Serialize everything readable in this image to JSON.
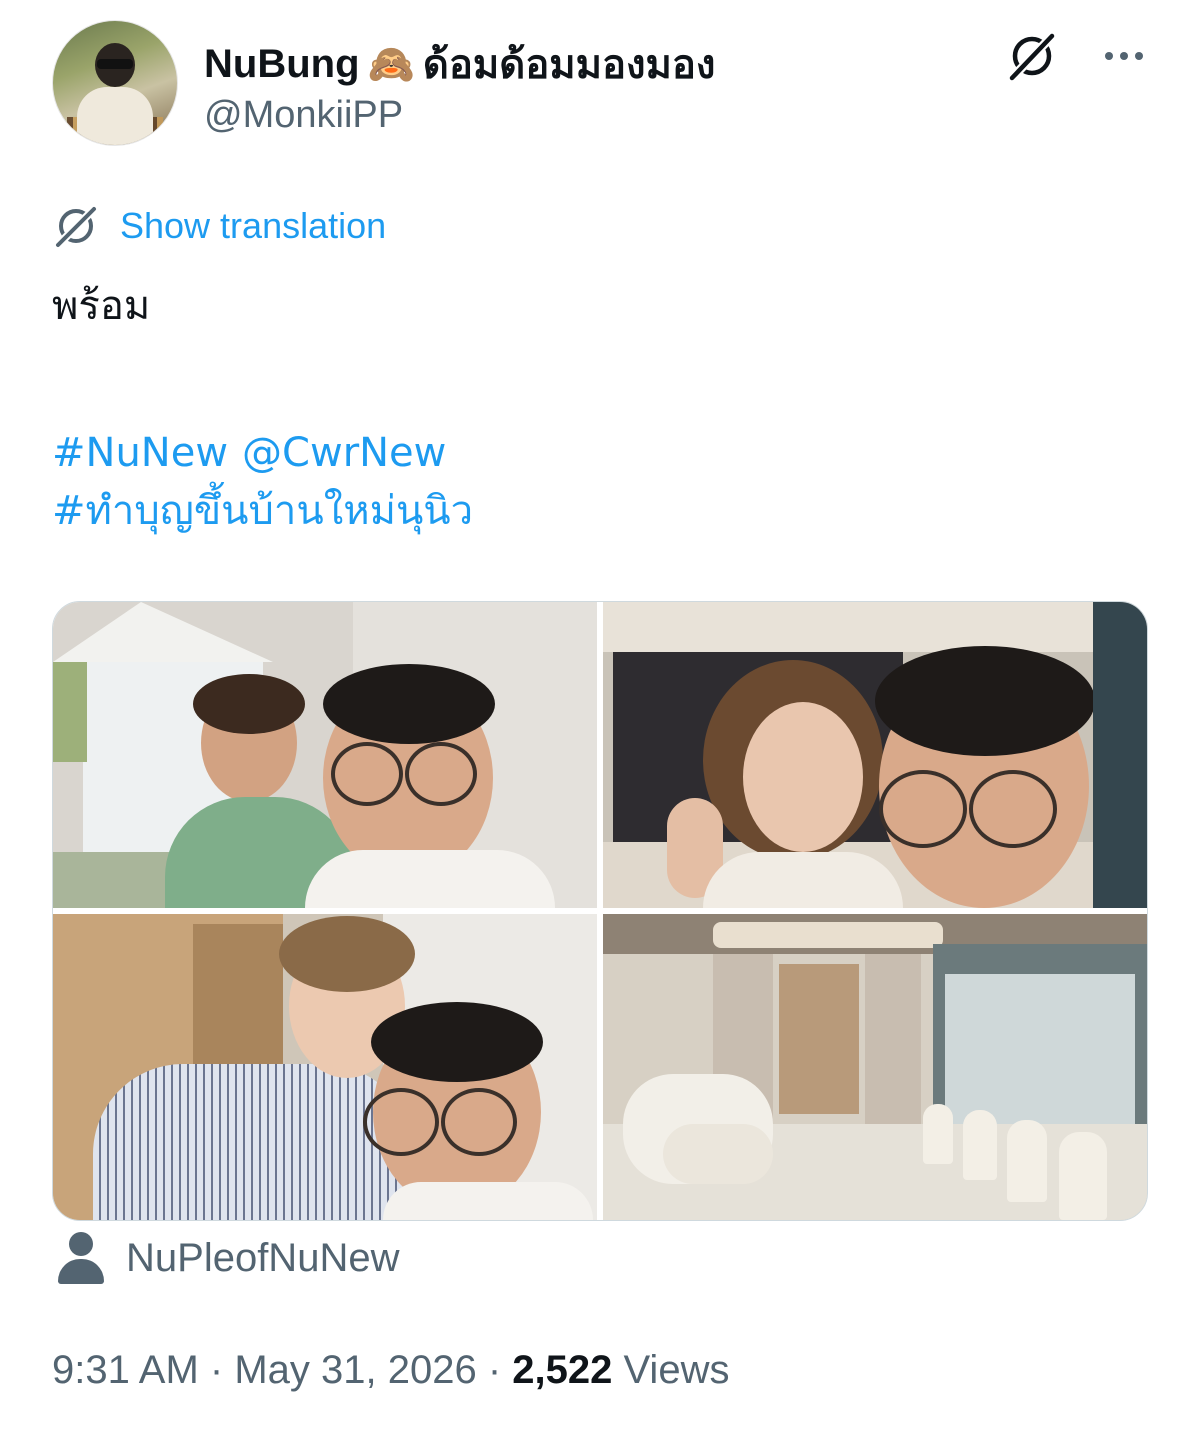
{
  "author": {
    "display_name": "NuBung",
    "display_emoji": "🙈",
    "display_suffix": "ด้อมด้อมมองมอง",
    "handle": "@MonkiiPP",
    "avatar_icon": "profile-photo"
  },
  "header_actions": {
    "grok_icon": "grok-icon",
    "more_icon": "more-dots-icon"
  },
  "translation": {
    "label": "Show translation",
    "icon": "grok-icon"
  },
  "tweet": {
    "text": "พร้อม",
    "hashtag_1": "#NuNew",
    "mention_1": "@CwrNew",
    "hashtag_2": "#ทำบุญขึ้นบ้านใหม่นุนิว"
  },
  "media": {
    "photo_count": 4
  },
  "community": {
    "icon": "person-icon",
    "name": "NuPleofNuNew"
  },
  "meta": {
    "time": "9:31 AM",
    "sep1": " · ",
    "date": "May 31, 2026",
    "sep2": " · ",
    "views_count": "2,522",
    "views_label": " Views"
  },
  "colors": {
    "link": "#1d9bf0",
    "secondary_text": "#536471",
    "primary_text": "#0f1419",
    "border": "#cfd9de"
  }
}
